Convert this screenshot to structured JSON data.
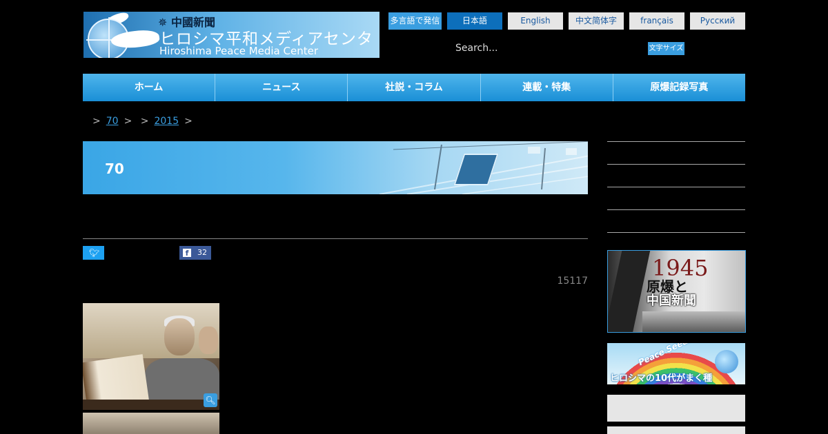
{
  "header": {
    "logo_line1": "中國新聞",
    "logo_line2": "ヒロシマ平和メディアセンター",
    "logo_line3": "Hiroshima Peace Media Center"
  },
  "languages": [
    {
      "label": "多言語で発信",
      "state": "accent"
    },
    {
      "label": "日本語",
      "state": "active"
    },
    {
      "label": "English",
      "state": "normal"
    },
    {
      "label": "中文简体字",
      "state": "normal"
    },
    {
      "label": "français",
      "state": "normal"
    },
    {
      "label": "Русский",
      "state": "normal"
    }
  ],
  "search": {
    "placeholder": "Search..."
  },
  "font_size_button": "文字サイズ",
  "nav": [
    {
      "label": "ホーム"
    },
    {
      "label": "ニュース"
    },
    {
      "label": "社説・コラム"
    },
    {
      "label": "連載・特集"
    },
    {
      "label": "原爆記録写真"
    }
  ],
  "breadcrumb": {
    "link1": "70",
    "link2": "2015"
  },
  "banner": {
    "title": "70"
  },
  "social": {
    "facebook_count": "32"
  },
  "views": "15117",
  "sidebar": {
    "year": "1945",
    "title1": "原爆と",
    "title2": "中国新聞",
    "peace_seeds": "Peace Seeds",
    "peace_sub": "ヒロシマの10代がまく種"
  },
  "colors": {
    "accent": "#3a9ee0",
    "active_lang": "#0d6fbb",
    "nav_top": "#4fb5ec",
    "nav_bottom": "#1a8fd6"
  }
}
